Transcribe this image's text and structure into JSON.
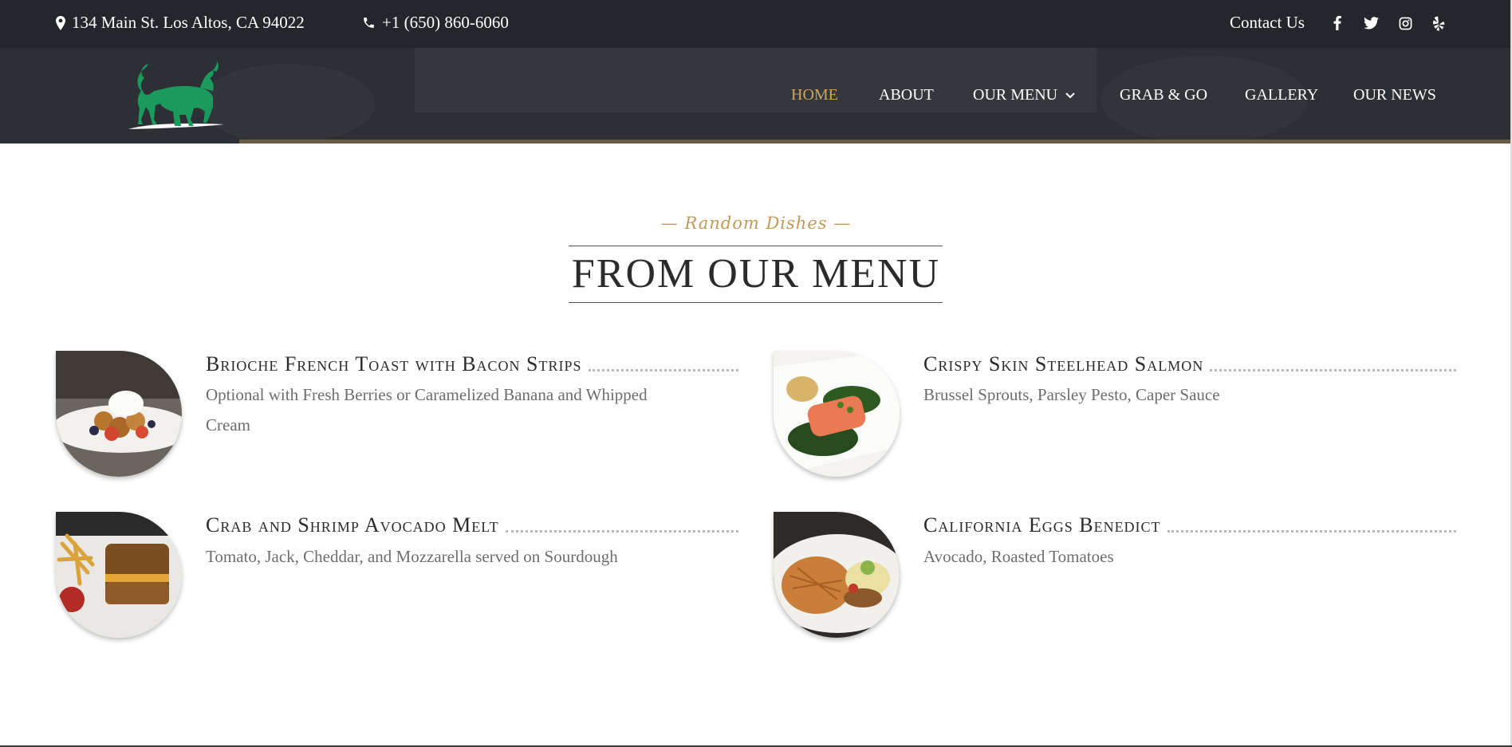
{
  "topbar": {
    "address": "134 Main St. Los Altos, CA 94022",
    "phone": "+1 (650) 860-6060",
    "contact_label": "Contact Us",
    "social_icons": [
      "facebook-icon",
      "twitter-icon",
      "instagram-icon",
      "yelp-icon"
    ]
  },
  "nav": {
    "items": [
      {
        "label": "HOME",
        "active": true
      },
      {
        "label": "ABOUT"
      },
      {
        "label": "OUR MENU",
        "has_dropdown": true
      },
      {
        "label": "GRAB & GO"
      },
      {
        "label": "GALLERY"
      },
      {
        "label": "OUR NEWS"
      }
    ]
  },
  "section": {
    "eyebrow": "— Random Dishes —",
    "title": "FROM OUR MENU"
  },
  "dishes": [
    {
      "title": "Brioche French Toast with Bacon Strips",
      "description_line1": "Optional with Fresh Berries or Caramelized Banana and Whipped",
      "description_line2": "Cream"
    },
    {
      "title": "Crispy Skin Steelhead Salmon",
      "description": "Brussel Sprouts, Parsley Pesto, Caper Sauce"
    },
    {
      "title": "Crab and Shrimp Avocado Melt",
      "description": "Tomato, Jack, Cheddar, and Mozzarella served on Sourdough"
    },
    {
      "title": "California Eggs Benedict",
      "description": "Avocado, Roasted Tomatoes"
    }
  ],
  "colors": {
    "topbar_bg": "#23272b",
    "nav_bg": "#2c2f33",
    "accent_gold": "#d1a463",
    "logo_green": "#1a9a5c"
  }
}
